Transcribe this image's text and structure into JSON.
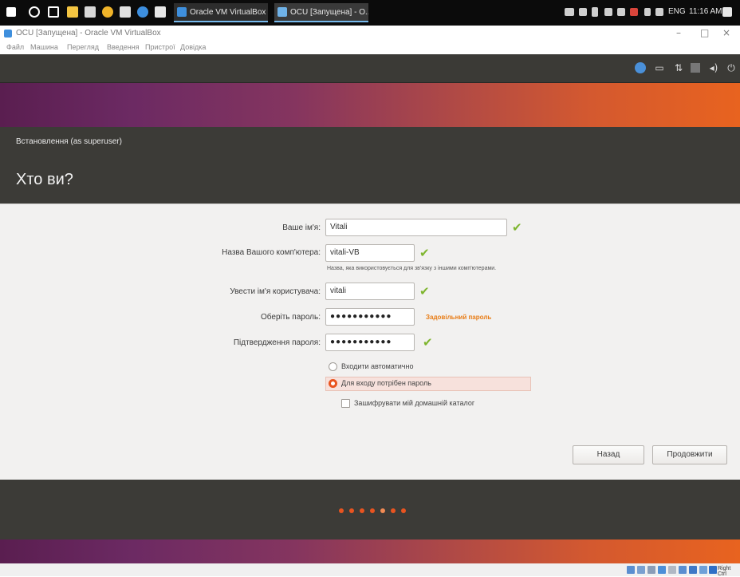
{
  "taskbar": {
    "tasks": [
      {
        "label": "Oracle VM VirtualBox ..."
      },
      {
        "label": "OCU [Запущена] - O..."
      }
    ],
    "tray": {
      "language": "ENG",
      "time": "11:16 AM"
    }
  },
  "vbox_window": {
    "title": "OCU [Запущена] - Oracle VM VirtualBox",
    "menu": [
      "Файл",
      "Машина",
      "Перегляд",
      "Введення",
      "Пристрої",
      "Довідка"
    ],
    "host_key": "Right Ctrl"
  },
  "installer": {
    "window_title": "Встановлення (as superuser)",
    "heading": "Хто ви?",
    "fields": {
      "name": {
        "label": "Ваше ім'я:",
        "value": "Vitali"
      },
      "computer": {
        "label": "Назва Вашого комп'ютера:",
        "value": "vitali-VB",
        "hint": "Назва, яка використовується для зв'язку з іншими комп'ютерами."
      },
      "username": {
        "label": "Увести ім'я користувача:",
        "value": "vitali"
      },
      "password": {
        "label": "Оберіть пароль:",
        "value": "●●●●●●●●●●●",
        "strength": "Задовільний пароль"
      },
      "confirm": {
        "label": "Підтвердження пароля:",
        "value": "●●●●●●●●●●●"
      }
    },
    "options": {
      "auto_login": "Входити автоматично",
      "require_password": "Для входу потрібен пароль",
      "encrypt_home": "Зашифрувати мій домашній каталог"
    },
    "buttons": {
      "back": "Назад",
      "continue": "Продовжити"
    },
    "progress": {
      "dots": 7,
      "current": 5
    }
  },
  "colors": {
    "accent": "#e95420",
    "check": "#7eb52e",
    "header_bg": "#3c3b37"
  }
}
